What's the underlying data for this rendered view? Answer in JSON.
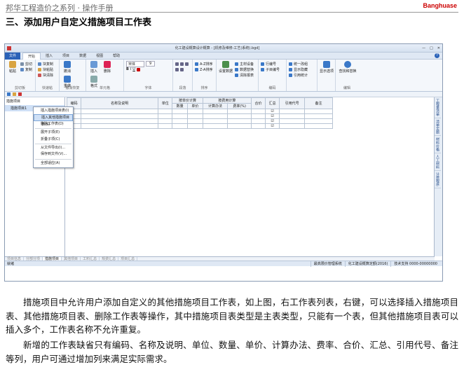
{
  "header": {
    "text": "邦华工程造价之系列 · 操作手册",
    "logo": "Banghuase"
  },
  "section_title": "三、添加用户自定义措施项目工作表",
  "screenshot": {
    "title": "化工建设概算设计概算 - [机修及维修-工艺(系统).bgd]",
    "window_buttons": [
      "—",
      "□",
      "✕"
    ],
    "menu": {
      "file": "文件",
      "items": [
        "开始",
        "插入",
        "项目",
        "数据",
        "视图",
        "帮助"
      ]
    },
    "ribbon_groups": [
      {
        "label": "剪切板",
        "buttons": [
          "粘贴"
        ],
        "small": [
          "剪切",
          "复制"
        ]
      },
      {
        "label": "快速粘",
        "small": [
          "块复制",
          "块粘贴",
          "块清除"
        ]
      },
      {
        "label": "撤消恢复",
        "buttons": [
          "撤消",
          "重做"
        ]
      },
      {
        "label": "单元格",
        "buttons": [
          "插入",
          "删除",
          "格式"
        ]
      },
      {
        "label": "字体",
        "small": [
          "宋体",
          "9"
        ]
      },
      {
        "label": "段落",
        "small": []
      },
      {
        "label": "排序",
        "small": [
          "A-Z排序",
          "Z-A排序"
        ]
      },
      {
        "label": "",
        "buttons": [
          "设置数据"
        ],
        "small": [
          "主材设备",
          "数据替换",
          "清除报表"
        ]
      },
      {
        "label": "编码",
        "small": [
          "行编号",
          "子目编号"
        ]
      },
      {
        "label": "",
        "small": [
          "统一改组",
          "显示隐藏",
          "引用统计"
        ]
      },
      {
        "label": "",
        "buttons": [
          "显示选项"
        ]
      },
      {
        "label": "编辑",
        "buttons": [
          "查找和替换"
        ]
      }
    ],
    "tree": {
      "root": "措施项目",
      "child": "措施项目1"
    },
    "table": {
      "group_headers": [
        "按单价计算",
        "按费用计算"
      ],
      "columns": [
        "编码",
        "名称及说明",
        "单位",
        "数量",
        "单价",
        "计算办法",
        "费率(%)",
        "合价",
        "汇总",
        "引用代号",
        "备注"
      ],
      "rows": 4
    },
    "context_menu": [
      "插入措施项目表(I)",
      "插入其他措施项目表(S)",
      "删除工作表(D)",
      "展开子项(E)",
      "折叠子项(C)",
      "从文件导出(I)...",
      "保存到文件(V)...",
      "全部适应(A)"
    ],
    "side_tabs": [
      "工程量清单",
      "清单定额",
      "材料价格",
      "人工材料",
      "计费程序"
    ],
    "sheet_tabs": [
      "项目信息",
      "分部分项",
      "措施项目",
      "其他项目",
      "工料汇总",
      "规费汇总",
      "项目汇总"
    ],
    "active_sheet": "措施项目",
    "status": {
      "left": "就绪",
      "cells": [
        "最高限价管理系统",
        "化工建设概算定额(2016)",
        "技术支持 0000-00000000"
      ]
    }
  },
  "paragraphs": [
    "措施项目中允许用户添加自定义的其他措施项目工作表，如上图，右工作表列表，右键，可以选择插入措施项目表、其他措施项目表、删除工作表等操作，其中措施项目表类型是主表类型，只能有一个表，但其他措施项目表可以插入多个，工作表名称不允许重复。",
    "新增的工作表缺省只有编码、名称及说明、单位、数量、单价、计算办法、费率、合价、汇总、引用代号、备注等列，用户可通过增加列来满足实际需求。"
  ]
}
